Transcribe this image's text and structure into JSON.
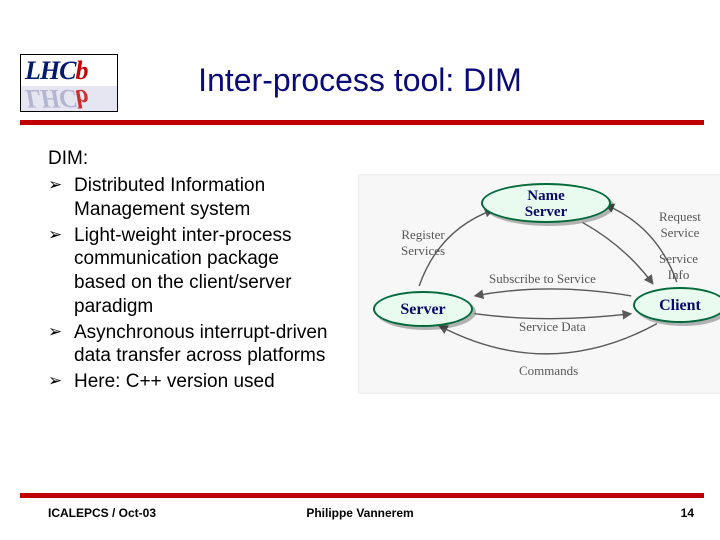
{
  "logo": {
    "text_html": "LHC",
    "accent": "b"
  },
  "title": "Inter-process tool: DIM",
  "intro": "DIM:",
  "bullets": [
    "Distributed Information Management system",
    "Light-weight inter-process communication package based on the client/server paradigm",
    "Asynchronous interrupt-driven data transfer across platforms",
    "Here: C++ version used"
  ],
  "diagram": {
    "nodes": {
      "name_server": "Name\nServer",
      "server": "Server",
      "client": "Client"
    },
    "edges": {
      "register_services": "Register\nServices",
      "request_service": "Request\nService",
      "service_info": "Service\nInfo",
      "subscribe": "Subscribe to Service",
      "service_data": "Service Data",
      "commands": "Commands"
    }
  },
  "footer": {
    "left": "ICALEPCS / Oct-03",
    "center": "Philippe Vannerem",
    "right": "14"
  }
}
